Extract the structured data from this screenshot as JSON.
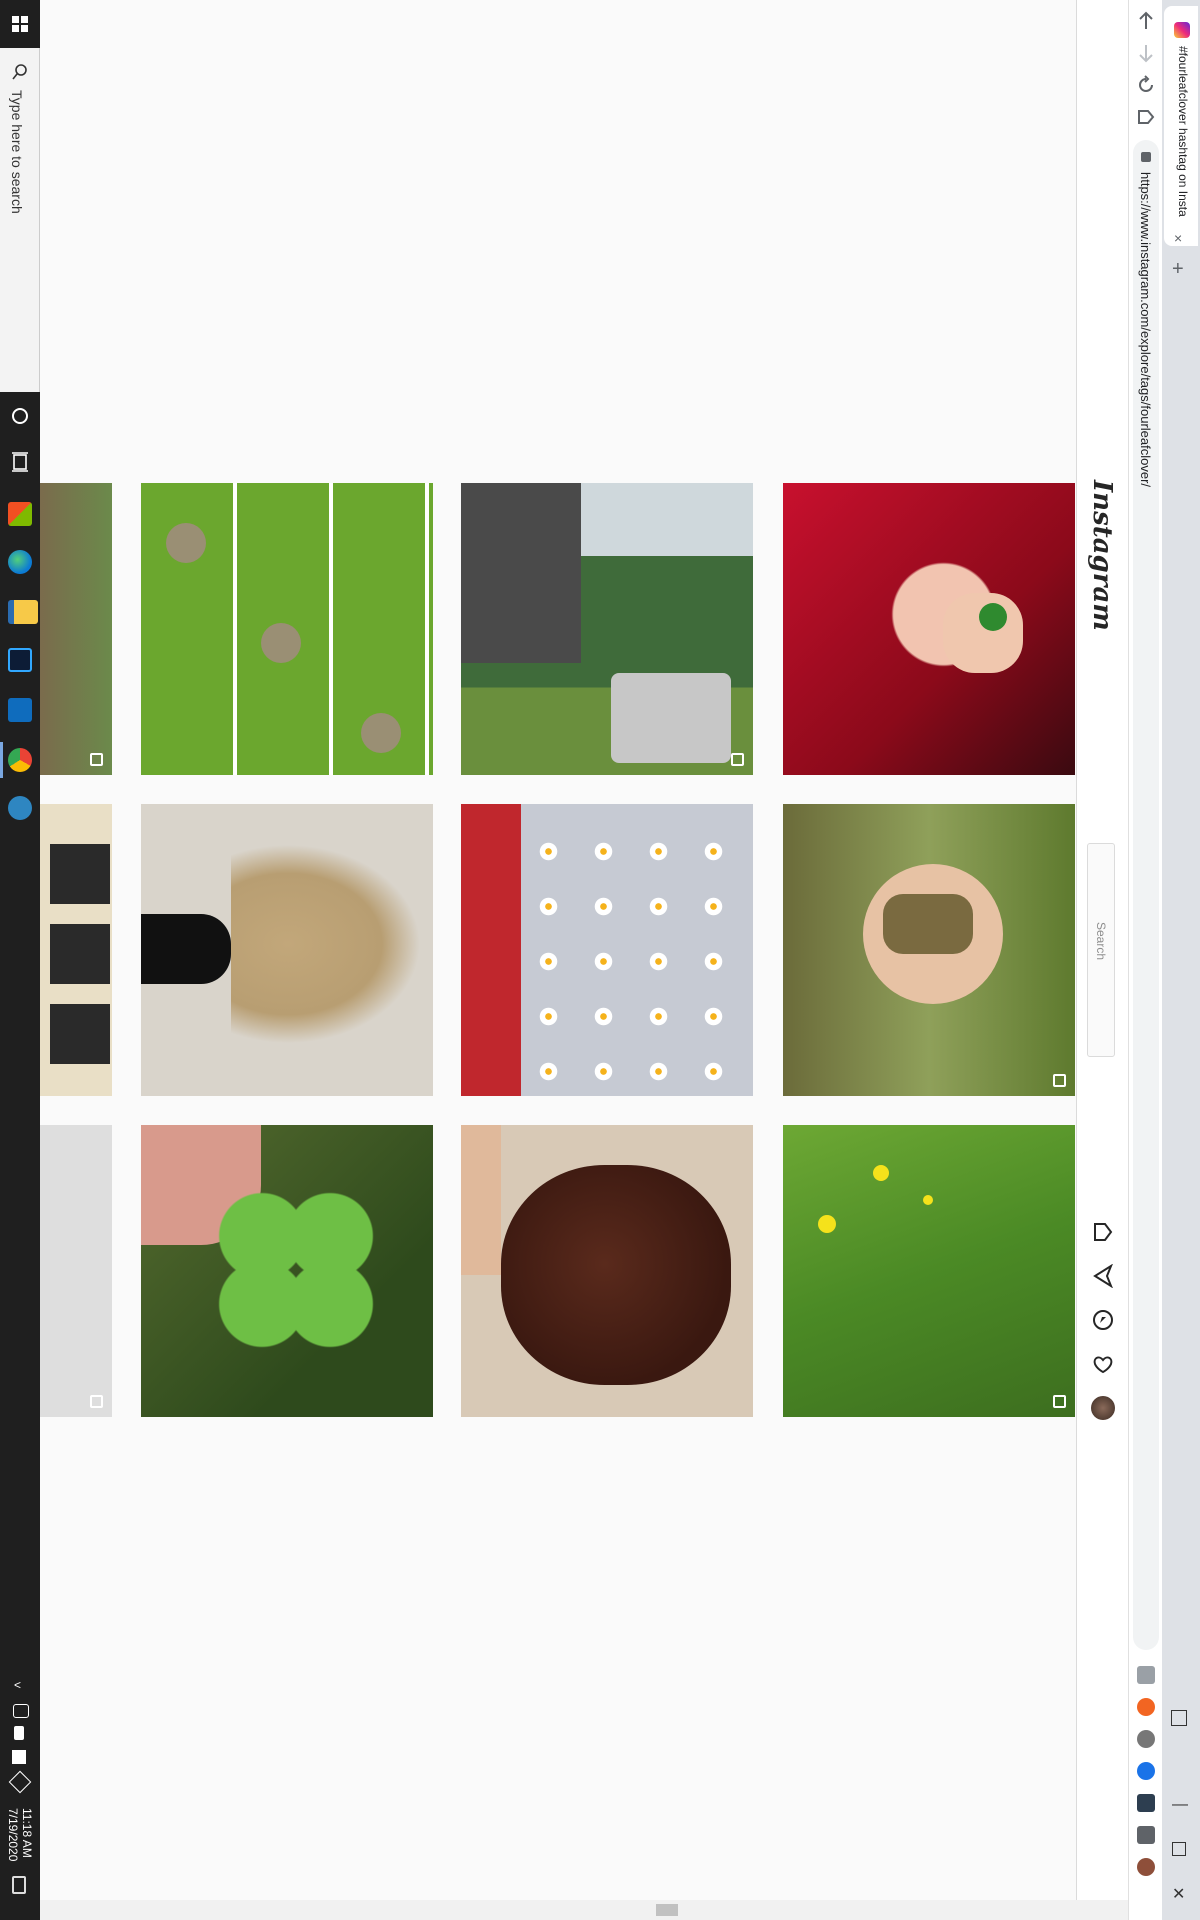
{
  "taskbar": {
    "search_placeholder": "Type here to search",
    "time": "11:18 AM",
    "date": "7/19/2020",
    "apps": [
      "cortana-icon",
      "task-view-icon",
      "microsoft-store-icon",
      "edge-icon",
      "file-explorer-icon",
      "photoshop-icon",
      "outlook-icon",
      "chrome-icon",
      "settings-icon"
    ]
  },
  "browser": {
    "tab_title": "#fourleafclover hashtag on Insta",
    "url": "https://www.instagram.com/explore/tags/fourleafclover/",
    "new_tab": "+",
    "tab_close": "×"
  },
  "instagram": {
    "logo": "Instagram",
    "search_placeholder": "Search",
    "nav": [
      "home-icon",
      "direct-icon",
      "explore-icon",
      "activity-heart-icon",
      "profile-avatar"
    ]
  },
  "colors": {
    "taskbar_bg": "#1f1f1f",
    "page_bg": "#fafafa",
    "accent": "#7aa7e0"
  },
  "posts": [
    {
      "name": "post-four-leaf-hand",
      "desc": "hand holding clover",
      "multi": false
    },
    {
      "name": "post-boy-clover",
      "multi": true
    },
    {
      "name": "post-grass-flowers",
      "multi": true
    },
    {
      "name": "post-hammock-trailer",
      "multi": true
    },
    {
      "name": "post-daisies",
      "multi": false
    },
    {
      "name": "post-hair",
      "multi": false
    },
    {
      "name": "post-coins-grid",
      "multi": false
    },
    {
      "name": "post-pampas",
      "multi": false
    },
    {
      "name": "post-clover-closeup",
      "multi": false
    },
    {
      "name": "post-partial-trees",
      "multi": true
    },
    {
      "name": "post-partial-sign",
      "multi": false
    },
    {
      "name": "post-partial-wall",
      "multi": true
    }
  ]
}
